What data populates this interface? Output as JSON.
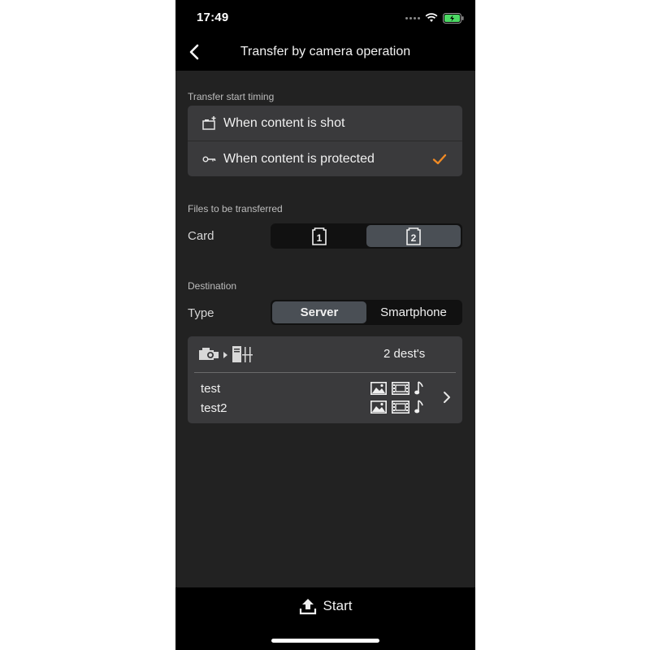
{
  "status_bar": {
    "time": "17:49"
  },
  "nav": {
    "title": "Transfer by camera operation"
  },
  "transfer_timing": {
    "section_label": "Transfer start timing",
    "options": [
      {
        "label": "When content is shot",
        "icon": "shoot-icon",
        "selected": false
      },
      {
        "label": "When content is protected",
        "icon": "key-icon",
        "selected": true
      }
    ]
  },
  "files": {
    "section_label": "Files to be transferred",
    "card_label": "Card",
    "card_options": [
      {
        "label": "1",
        "icon": "card-slot-1-icon",
        "selected": false
      },
      {
        "label": "2",
        "icon": "card-slot-2-icon",
        "selected": true
      }
    ]
  },
  "destination": {
    "section_label": "Destination",
    "type_label": "Type",
    "type_options": [
      {
        "label": "Server",
        "selected": true
      },
      {
        "label": "Smartphone",
        "selected": false
      }
    ],
    "count": "2 dest's",
    "items": [
      {
        "name": "test"
      },
      {
        "name": "test2"
      }
    ]
  },
  "footer": {
    "start_label": "Start"
  },
  "colors": {
    "accent": "#f08a24",
    "background": "#222222",
    "bar": "#000000",
    "cell": "#3a3a3c"
  }
}
